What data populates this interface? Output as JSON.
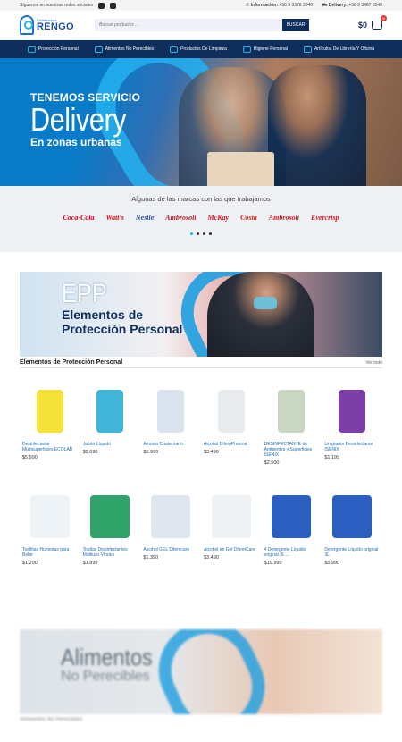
{
  "topbar": {
    "social_text": "Síguenos en nuestras redes sociales",
    "info_label": "Información:",
    "info_phone": "+56 9 3378 2040",
    "delivery_label": "Delivery:",
    "delivery_phone": "+56 9 3467 3540"
  },
  "header": {
    "logo_small": "Distribuidora",
    "logo_big": "RENGO",
    "search_placeholder": "Buscar productos ...",
    "search_button": "BUSCAR",
    "cart_total": "$0",
    "cart_count": "0"
  },
  "nav": {
    "items": [
      "Protección Personal",
      "Alimentos No Perecibles",
      "Productos De Limpieza",
      "Higiene Personal",
      "Artículos De Librería Y Oficina"
    ]
  },
  "hero": {
    "line1": "TENEMOS SERVICIO",
    "line2": "Delivery",
    "line3": "En zonas urbanas"
  },
  "brands": {
    "title": "Algunas de las marcas con las que trabajamos",
    "items": [
      {
        "name": "Coca-Cola",
        "color": "#d9001b"
      },
      {
        "name": "Watt's",
        "color": "#d40d12"
      },
      {
        "name": "Nestlé",
        "color": "#2d4c9e"
      },
      {
        "name": "Ambrosoli",
        "color": "#b21e23"
      },
      {
        "name": "McKay",
        "color": "#d9151b"
      },
      {
        "name": "Costa",
        "color": "#e1251b"
      },
      {
        "name": "Ambrosoli",
        "color": "#c41b21"
      },
      {
        "name": "Evercrisp",
        "color": "#d9151b"
      }
    ]
  },
  "epp_banner": {
    "line1": "EPP",
    "line2": "Elementos de",
    "line3": "Protección Personal"
  },
  "epp_section": {
    "title": "Elementos de Protección Personal",
    "see_all": "Ver todo",
    "products": [
      {
        "name": "Desinfectante Multisuperficies ECOLAB",
        "price": "$5.990",
        "color": "#f2e23a",
        "icon": "yellow-bottle-icon"
      },
      {
        "name": "Jabón Líquido",
        "price": "$2.090",
        "color": "#3fb6d8",
        "icon": "soap-bottle-icon"
      },
      {
        "name": "Amonio Cuaternario",
        "price": "$5.990",
        "color": "#d9e4ef",
        "icon": "spray-bottle-icon"
      },
      {
        "name": "Alcohol DifemPharma",
        "price": "$3.490",
        "color": "#e8ecef",
        "icon": "spray-bottle-icon"
      },
      {
        "name": "DESINFECTANTE de Ambientes y Superficies ISENIX",
        "price": "$2.500",
        "color": "#c9d7c2",
        "icon": "spray-bottle-icon"
      },
      {
        "name": "Limpiador Desinfectante ISENIX",
        "price": "$1.199",
        "color": "#7c3fa8",
        "icon": "bottle-icon"
      },
      {
        "name": "Toallitas Húmedas para Bebé",
        "price": "$1.290",
        "color": "#eef3f7",
        "icon": "wipes-pack-icon"
      },
      {
        "name": "Toallas Desinfectantes Multiuso Virutex",
        "price": "$1.899",
        "color": "#2fa36a",
        "icon": "wipes-canister-icon"
      },
      {
        "name": "Alcohol GEL Difemcare",
        "price": "$1.390",
        "color": "#dfe6ee",
        "icon": "gel-bottle-icon"
      },
      {
        "name": "Alcohol en Gel DifemCare",
        "price": "$3.490",
        "color": "#eef2f5",
        "icon": "pump-bottle-icon"
      },
      {
        "name": "4 Detergente Líquido original 3L ...",
        "price": "$19.990",
        "color": "#2b5fbf",
        "icon": "detergent-pack-icon"
      },
      {
        "name": "Detergente Líquido original 3L",
        "price": "$5.990",
        "color": "#2b5fbf",
        "icon": "detergent-bottle-icon"
      }
    ]
  },
  "alimentos_banner": {
    "line1": "Alimentos",
    "line2": "No Perecibles"
  },
  "alimentos_section": {
    "title": "Alimentos No Perecibles"
  }
}
